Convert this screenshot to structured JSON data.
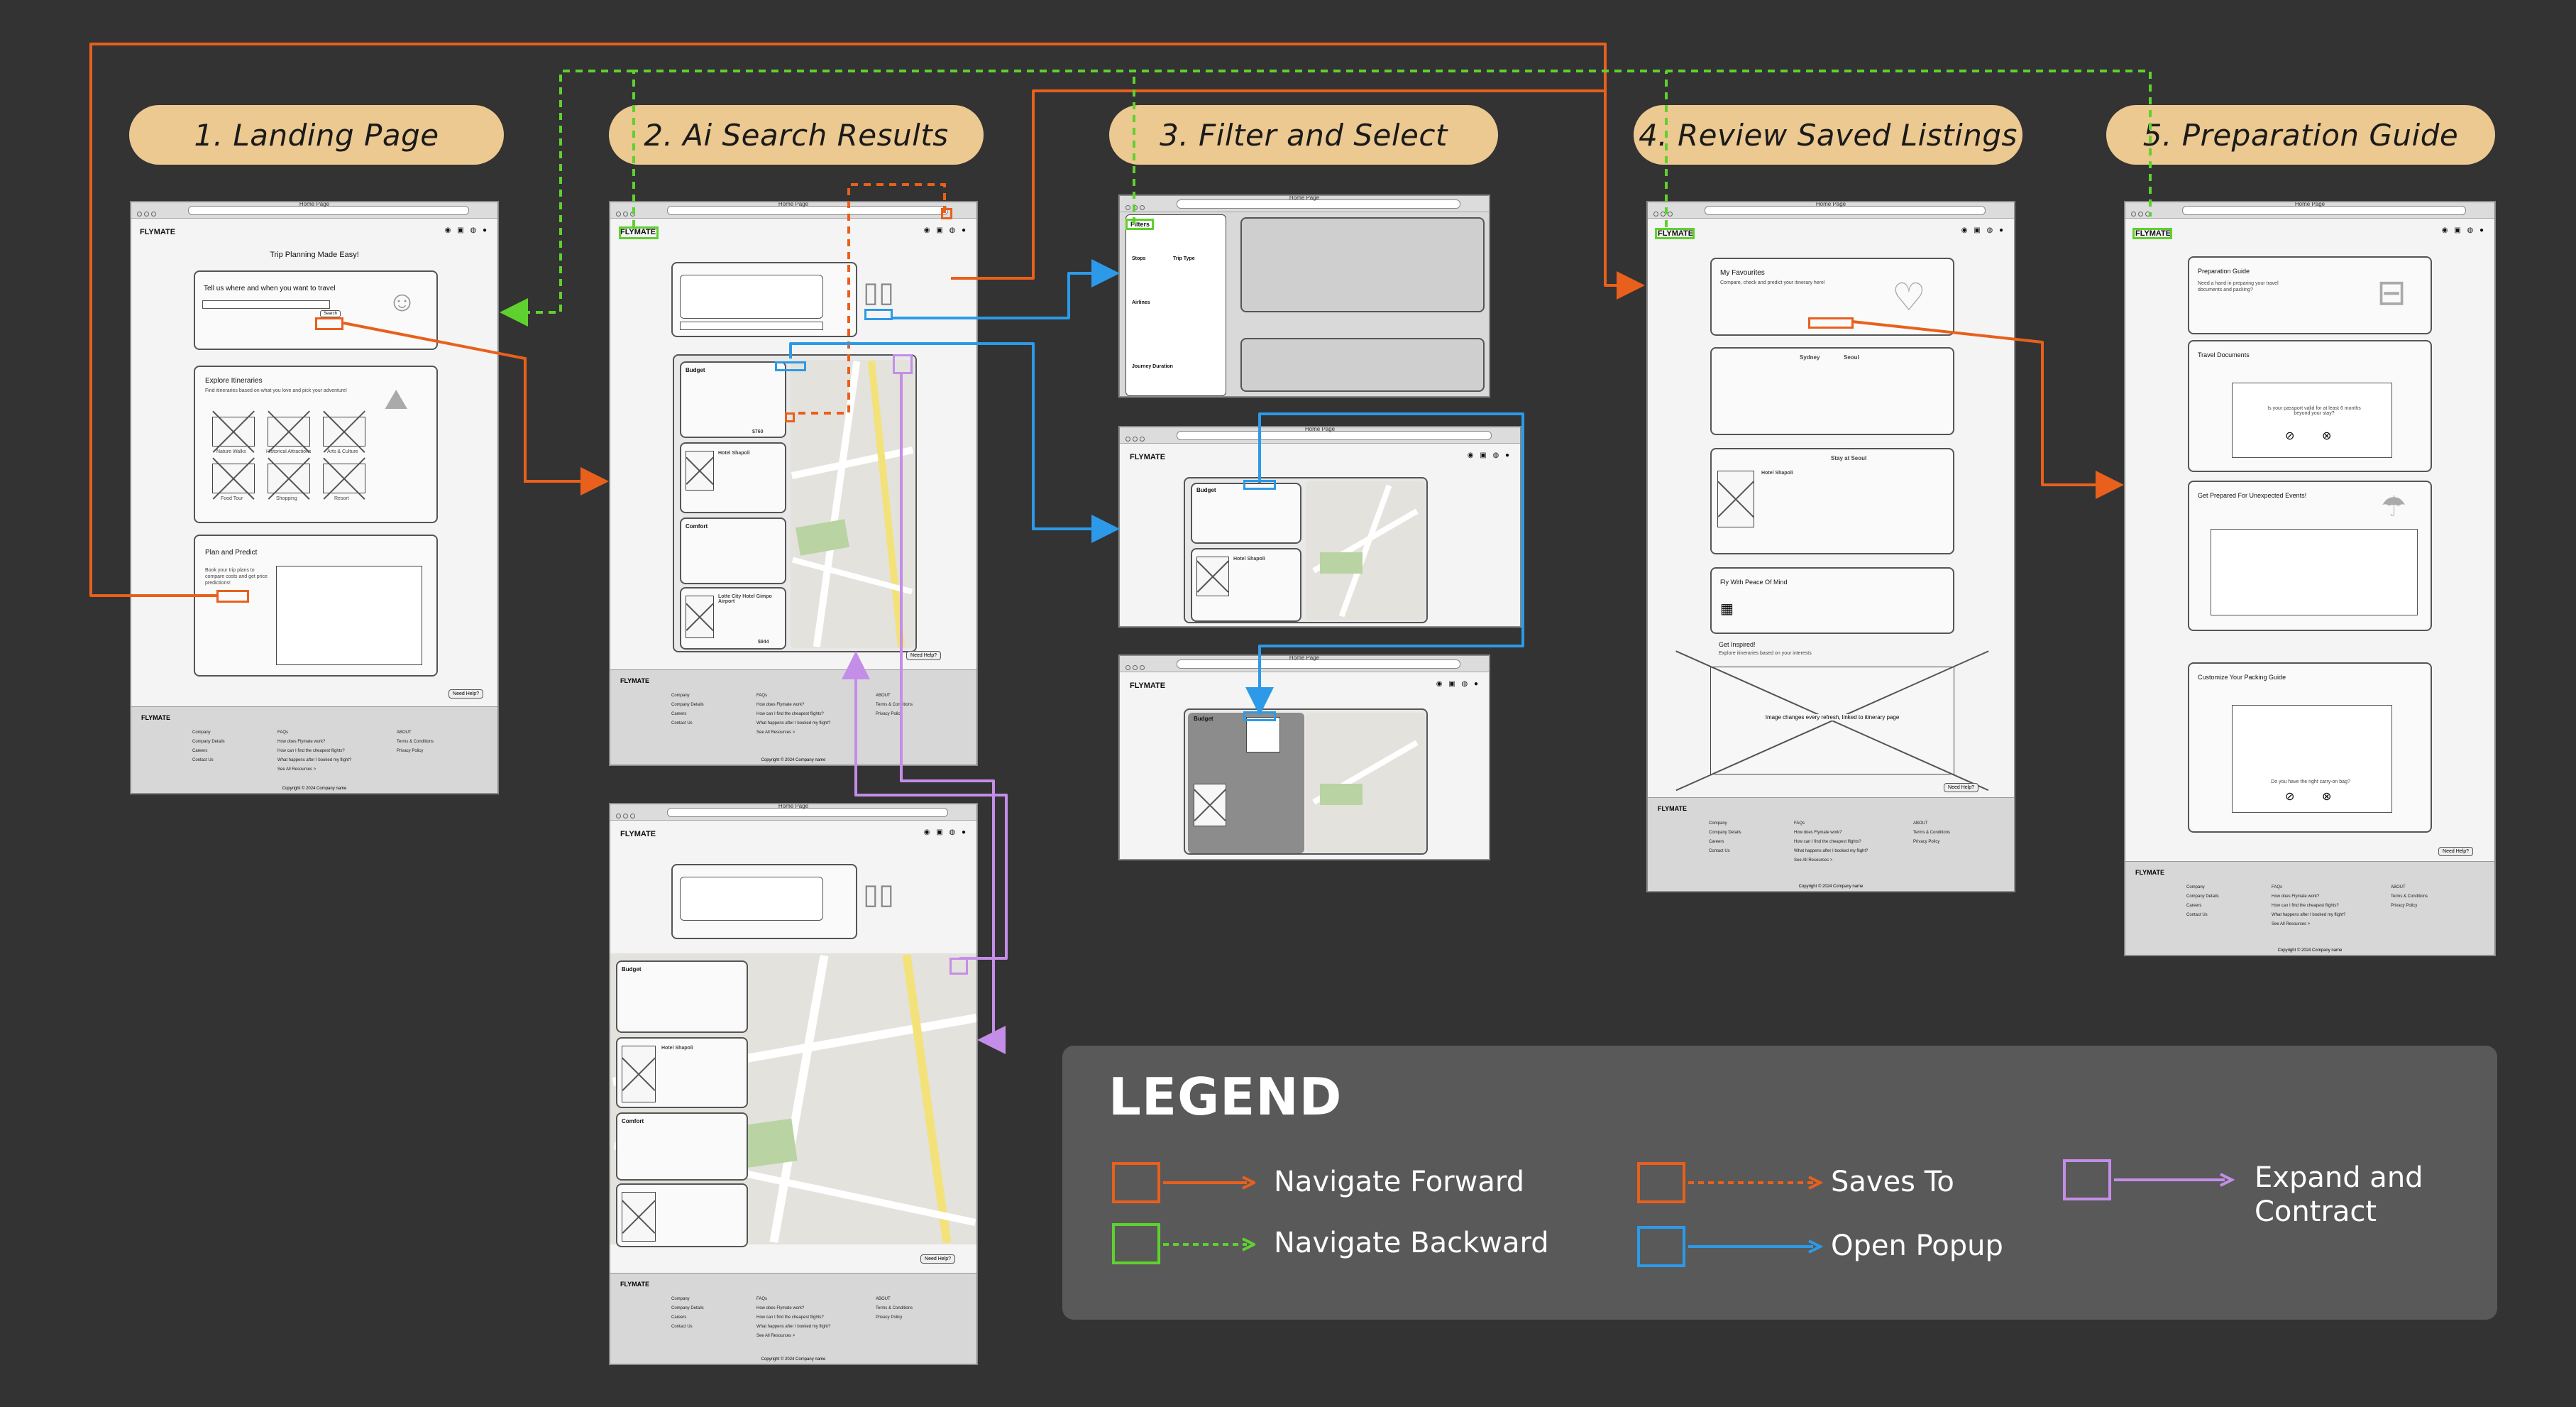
{
  "steps": [
    {
      "label": "1. Landing Page"
    },
    {
      "label": "2. Ai Search Results"
    },
    {
      "label": "3. Filter and Select"
    },
    {
      "label": "4. Review Saved Listings"
    },
    {
      "label": "5. Preparation Guide"
    }
  ],
  "browser_title": "Home Page",
  "brand": "FLYMATE",
  "landing": {
    "heading": "Trip Planning Made Easy!",
    "ask": "Tell us where and when you want to travel",
    "explore_title": "Explore Itineraries",
    "explore_sub": "Find itineraries based on what you love and pick your adventure!",
    "tiles": [
      "Nature Walks",
      "Historical Attractions",
      "Arts & Culture",
      "Food Tour",
      "Shopping",
      "Resort"
    ],
    "plan_title": "Plan and Predict",
    "plan_text": "Book your trip plans to compare costs and get price predictions!",
    "need_help": "Need Help?"
  },
  "results": {
    "budget": "Budget",
    "comfort": "Comfort",
    "hotel": "Hotel Shapoli",
    "hotel2": "Lotte City Hotel Gimpo Airport",
    "price": "$760",
    "price2": "$944",
    "need_help": "Need Help?"
  },
  "filters": {
    "title": "Filters",
    "stops": "Stops",
    "trip_type": "Trip Type",
    "airlines": "Airlines",
    "journey": "Journey Duration"
  },
  "review": {
    "favourites": "My Favourites",
    "fav_sub": "Compare, check and predict your itinerary here!",
    "flight_from": "Sydney",
    "flight_to": "Seoul",
    "stay": "Stay at Seoul",
    "hotel": "Hotel Shapoli",
    "peace_title": "Fly With Peace Of Mind",
    "inspired_title": "Get Inspired!",
    "inspired_sub": "Explore itineraries based on your interests",
    "image_note": "Image changes every refresh, linked to itinerary page",
    "need_help": "Need Help?"
  },
  "prep": {
    "guide_title": "Preparation Guide",
    "guide_sub": "Need a hand in preparing your travel documents and packing?",
    "docs_title": "Travel Documents",
    "docs_q": "Is your passport valid for at least 6 months beyond your stay?",
    "events_title": "Get Prepared For Unexpected Events!",
    "pack_title": "Customize Your Packing Guide",
    "pack_q": "Do you have the right carry-on bag?",
    "need_help": "Need Help?"
  },
  "footer": {
    "brand": "FLYMATE",
    "col1": [
      "Company",
      "Company Details",
      "Careers",
      "Contact Us"
    ],
    "col2": [
      "FAQs",
      "How does Flymate work?",
      "How can I find the cheapest flights?",
      "What happens after I booked my flight?",
      "See All Resources >"
    ],
    "col3": [
      "ABOUT",
      "Terms & Conditions",
      "Privacy Policy"
    ],
    "copyright": "Copyright © 2024 Company name"
  },
  "legend": {
    "title": "LEGEND",
    "items": [
      {
        "label": "Navigate Forward",
        "color": "#e8601c"
      },
      {
        "label": "Navigate Backward",
        "color": "#5fd12e"
      },
      {
        "label": "Saves To",
        "color": "#e8601c"
      },
      {
        "label": "Open Popup",
        "color": "#2c9ae8"
      },
      {
        "label": "Expand and Contract",
        "color": "#c48ee8"
      }
    ]
  },
  "colors": {
    "background": "#333333",
    "pill": "#ecc991",
    "forward": "#e8601c",
    "backward": "#5fd12e",
    "popup": "#2c9ae8",
    "expand": "#c48ee8"
  }
}
